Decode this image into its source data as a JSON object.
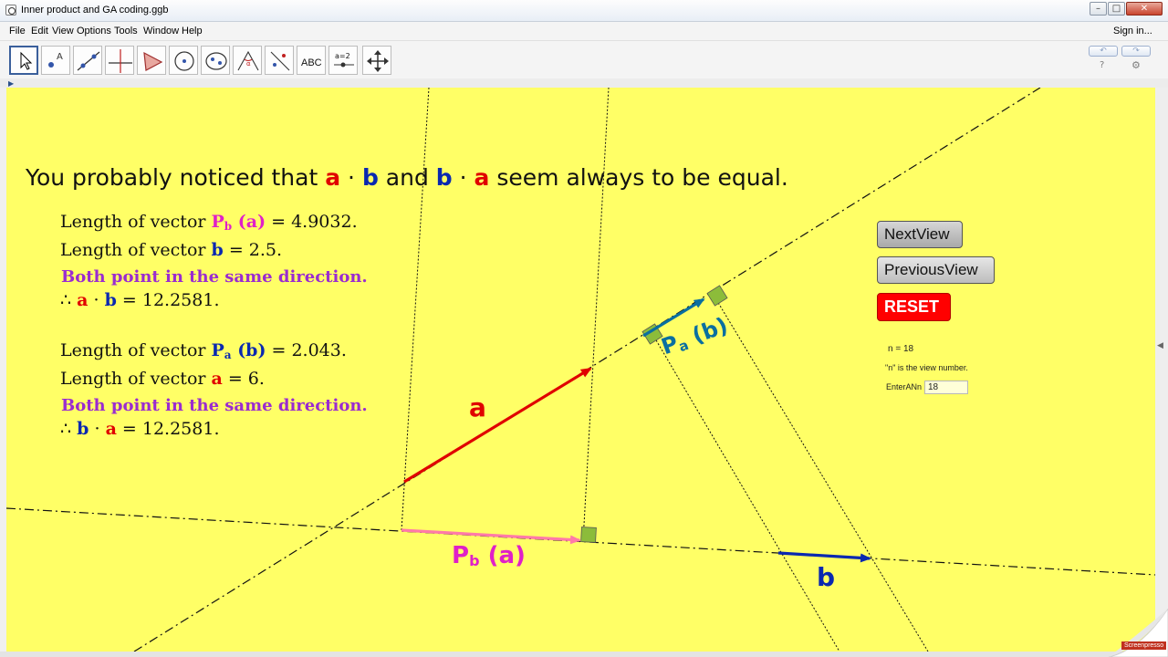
{
  "window": {
    "title": "Inner product and GA coding.ggb",
    "minimize": "–",
    "maximize": "□",
    "close": "✕"
  },
  "menu": {
    "items": [
      "File",
      "Edit",
      "View",
      "Options",
      "Tools",
      "Window",
      "Help"
    ],
    "sign_in": "Sign in..."
  },
  "toolbar": {
    "tools": [
      "move-tool",
      "point-tool",
      "line-tool",
      "perpendicular-line-tool",
      "polygon-tool",
      "circle-tool",
      "conic-tool",
      "angle-tool",
      "reflect-tool",
      "text-tool",
      "slider-tool",
      "move-graphics-view-tool"
    ],
    "text_tool_label": "ABC",
    "slider_tool_label": "a=2",
    "help": "?",
    "settings": "⚙"
  },
  "canvas": {
    "heading": {
      "part1": "You probably noticed that ",
      "a1": "a",
      "dot1": " · ",
      "b1": "b",
      "and": " and ",
      "b2": "b",
      "dot2": " · ",
      "a2": "a",
      "part2": " seem always to be equal."
    },
    "block1": {
      "line1_prefix": "Length of vector ",
      "line1_P": "P",
      "line1_sub": "b",
      "line1_arg": " (a)",
      "line1_value": " = 4.9032.",
      "line2_prefix": "Length of vector ",
      "line2_b": "b",
      "line2_value": " = 2.5.",
      "direction": "Both point in the same direction.",
      "therefore": "∴ ",
      "res_a": "a",
      "res_dot": " · ",
      "res_b": "b",
      "res_value": " = 12.2581."
    },
    "block2": {
      "line1_prefix": "Length of vector ",
      "line1_P": "P",
      "line1_sub": "a",
      "line1_arg": " (b)",
      "line1_value": " = 2.043.",
      "line2_prefix": "Length of vector ",
      "line2_a": "a",
      "line2_value": " = 6.",
      "direction": "Both point in the same direction.",
      "therefore": "∴ ",
      "res_b": "b",
      "res_dot": " · ",
      "res_a": "a",
      "res_value": " = 12.2581."
    },
    "buttons": {
      "next": "NextView",
      "previous": "PreviousView",
      "reset": "RESET"
    },
    "n_label": "n  =  18",
    "n_caption": "\"n\" is the view number.",
    "enter_label": "EnterANn",
    "enter_value": "18",
    "labels": {
      "a": "a",
      "b": "b",
      "pb": "P",
      "pb_sub": "b",
      "pb_arg": " (a)",
      "pa": "P",
      "pa_sub": "a",
      "pa_arg": " (b)"
    },
    "colors": {
      "background": "#ffff66",
      "vector_a": "#e00000",
      "vector_b": "#0a28b0",
      "projection_b": "#ff7aa8",
      "projection_a": "#0a6fa0",
      "right_angle": "#8cbc3a"
    }
  },
  "watermark": "Screenpresso"
}
